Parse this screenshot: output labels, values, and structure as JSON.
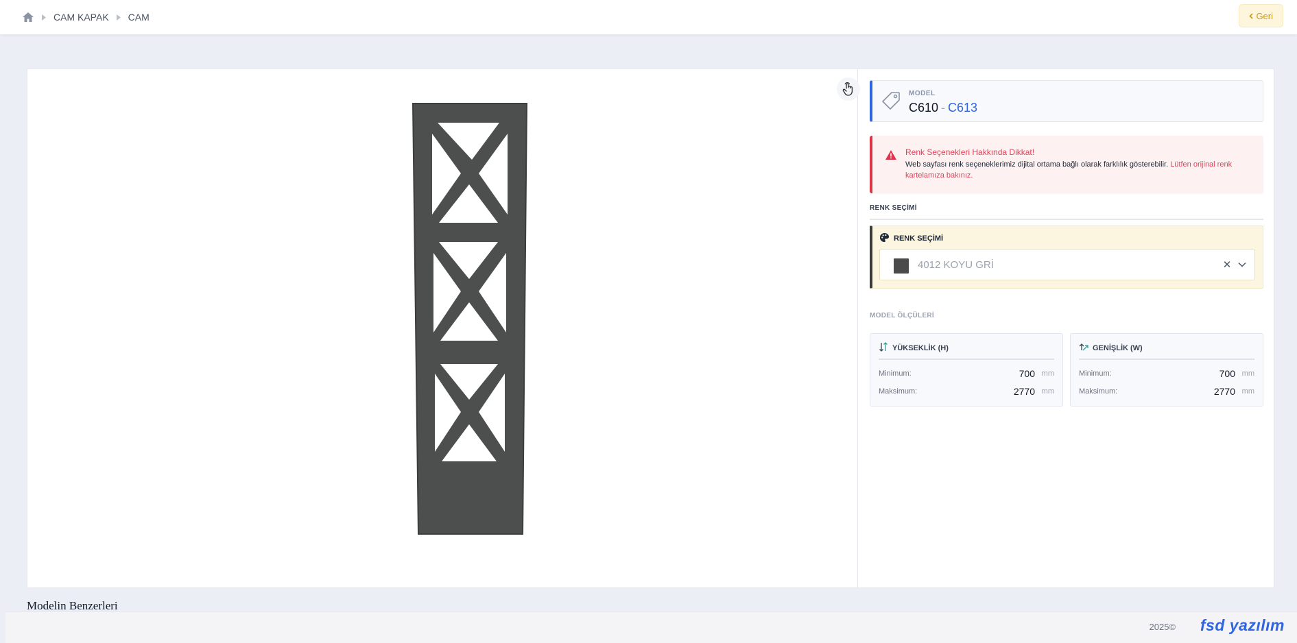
{
  "breadcrumb": {
    "home_icon": "home-icon",
    "items": [
      {
        "label": "CAM KAPAK"
      },
      {
        "label": "CAM"
      }
    ]
  },
  "header": {
    "back_label": "Geri"
  },
  "viewer": {
    "hand_icon": "touch-hand-icon",
    "panel_color": "#4d4f4f"
  },
  "model": {
    "caption": "MODEL",
    "code": "C610",
    "separator": "-",
    "alt_code": "C613"
  },
  "warning": {
    "title": "Renk Seçenekleri Hakkında Dikkat!",
    "text": "Web sayfası renk seçeneklerimiz dijital ortama bağlı olarak farklılık gösterebilir.",
    "highlight": "Lütfen orijinal renk kartelamıza bakınız."
  },
  "color_section": {
    "label": "RENK SEÇİMİ",
    "box_title": "RENK SEÇİMİ",
    "selected": "4012 KOYU GRİ",
    "swatch": "#4b4b4b"
  },
  "dimensions": {
    "label": "MODEL ÖLÇÜLERİ",
    "height": {
      "title": "YÜKSEKLİK (H)",
      "min_label": "Minimum:",
      "min_value": "700",
      "max_label": "Maksimum:",
      "max_value": "2770",
      "unit": "mm"
    },
    "width": {
      "title": "GENİŞLİK (W)",
      "min_label": "Minimum:",
      "min_value": "700",
      "max_label": "Maksimum:",
      "max_value": "2770",
      "unit": "mm"
    }
  },
  "similar": {
    "title": "Modelin Benzerleri"
  },
  "footer": {
    "year": "2025©",
    "brand": "fsd yazılım"
  },
  "colors": {
    "accent_blue": "#2f66e0",
    "warning_red": "#dc3545",
    "back_button_text": "#c79a1e"
  }
}
